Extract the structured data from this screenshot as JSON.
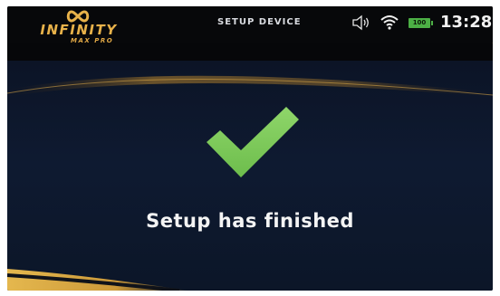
{
  "header": {
    "logo_main": "INFINITY",
    "logo_sub": "MAX PRO",
    "title": "SETUP DEVICE",
    "battery_level": "100",
    "clock": "13:28"
  },
  "status_icons": [
    "speaker-icon",
    "wifi-icon",
    "battery-icon"
  ],
  "main": {
    "icon": "checkmark-icon",
    "message": "Setup has finished"
  },
  "colors": {
    "accent_gold": "#e8b24a",
    "check_green": "#7ecb5a",
    "battery_green": "#4caf45",
    "background_navy": "#0e1a31"
  }
}
